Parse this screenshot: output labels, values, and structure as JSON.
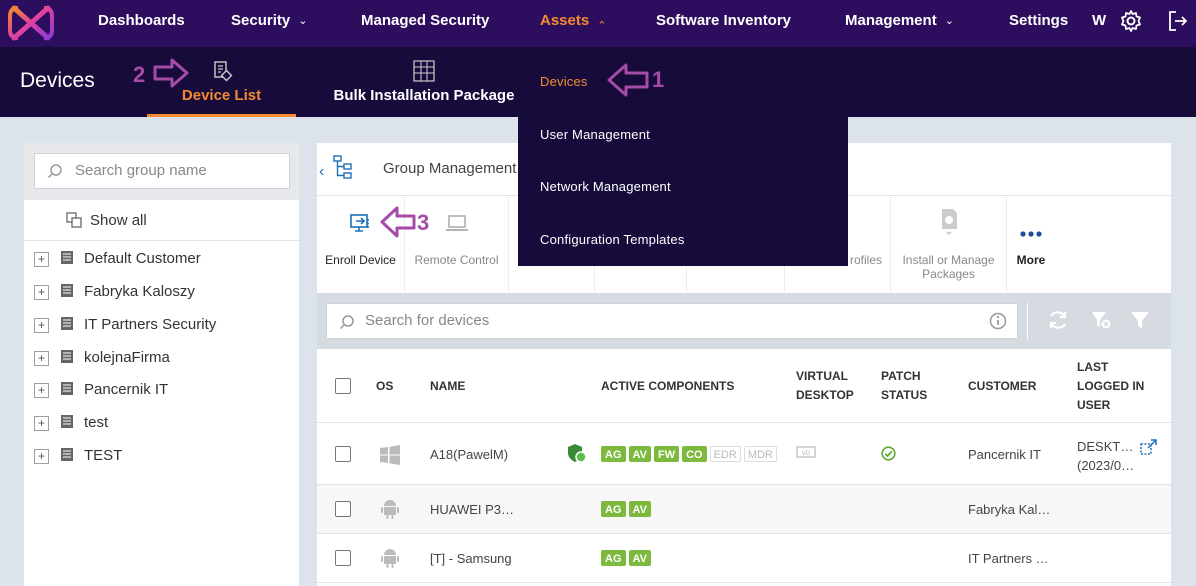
{
  "nav": {
    "items": [
      {
        "label": "Dashboards",
        "chevron": false
      },
      {
        "label": "Security",
        "chevron": true
      },
      {
        "label": "Managed Security",
        "chevron": false
      },
      {
        "label": "Assets",
        "chevron": true,
        "active": true
      },
      {
        "label": "Software Inventory",
        "chevron": false
      },
      {
        "label": "Management",
        "chevron": true
      },
      {
        "label": "Settings",
        "chevron": false
      }
    ],
    "user_initial": "W",
    "accent": "#f58a2e",
    "background": "#2d0d5e"
  },
  "subheader": {
    "title": "Devices",
    "tabs": [
      {
        "label": "Device List",
        "active": true
      },
      {
        "label": "Bulk Installation Package",
        "active": false
      }
    ]
  },
  "annotations": {
    "step1": "1",
    "step2": "2",
    "step3": "3",
    "color": "#a54ba8"
  },
  "dropdown": {
    "items": [
      {
        "label": "Devices",
        "active": true
      },
      {
        "label": "User Management",
        "active": false
      },
      {
        "label": "Network Management",
        "active": false
      },
      {
        "label": "Configuration Templates",
        "active": false
      }
    ]
  },
  "groups": {
    "search_placeholder": "Search group name",
    "show_all": "Show all",
    "items": [
      "Default Customer",
      "Fabryka Kaloszy",
      "IT Partners Security",
      "kolejnaFirma",
      "Pancernik IT",
      "test",
      "TEST"
    ]
  },
  "group_management": {
    "label": "Group Management"
  },
  "toolbar": {
    "enroll": "Enroll Device",
    "remote": "Remote Control",
    "profiles": "rofiles",
    "install_line1": "Install or Manage",
    "install_line2": "Packages",
    "more": "More"
  },
  "device_search": {
    "placeholder": "Search for devices"
  },
  "table": {
    "headers": {
      "os": "OS",
      "name": "NAME",
      "components": "ACTIVE COMPONENTS",
      "vd1": "VIRTUAL",
      "vd2": "DESKTOP",
      "ps1": "PATCH",
      "ps2": "STATUS",
      "customer": "CUSTOMER",
      "lu1": "LAST",
      "lu2": "LOGGED IN",
      "lu3": "USER"
    },
    "rows": [
      {
        "os": "windows",
        "name": "A18(PawelM)",
        "components_on": [
          "AG",
          "AV",
          "FW",
          "CO"
        ],
        "components_off": [
          "EDR",
          "MDR"
        ],
        "customer": "Pancernik IT",
        "last_user_1": "DESKT…",
        "last_user_2": "(2023/0…"
      },
      {
        "os": "android",
        "name": "HUAWEI P3…",
        "components_on": [
          "AG",
          "AV"
        ],
        "components_off": [],
        "customer": "Fabryka Kal…",
        "last_user_1": "",
        "last_user_2": ""
      },
      {
        "os": "android",
        "name": "[T] - Samsung",
        "components_on": [
          "AG",
          "AV"
        ],
        "components_off": [],
        "customer": "IT Partners …",
        "last_user_1": "",
        "last_user_2": ""
      }
    ]
  }
}
